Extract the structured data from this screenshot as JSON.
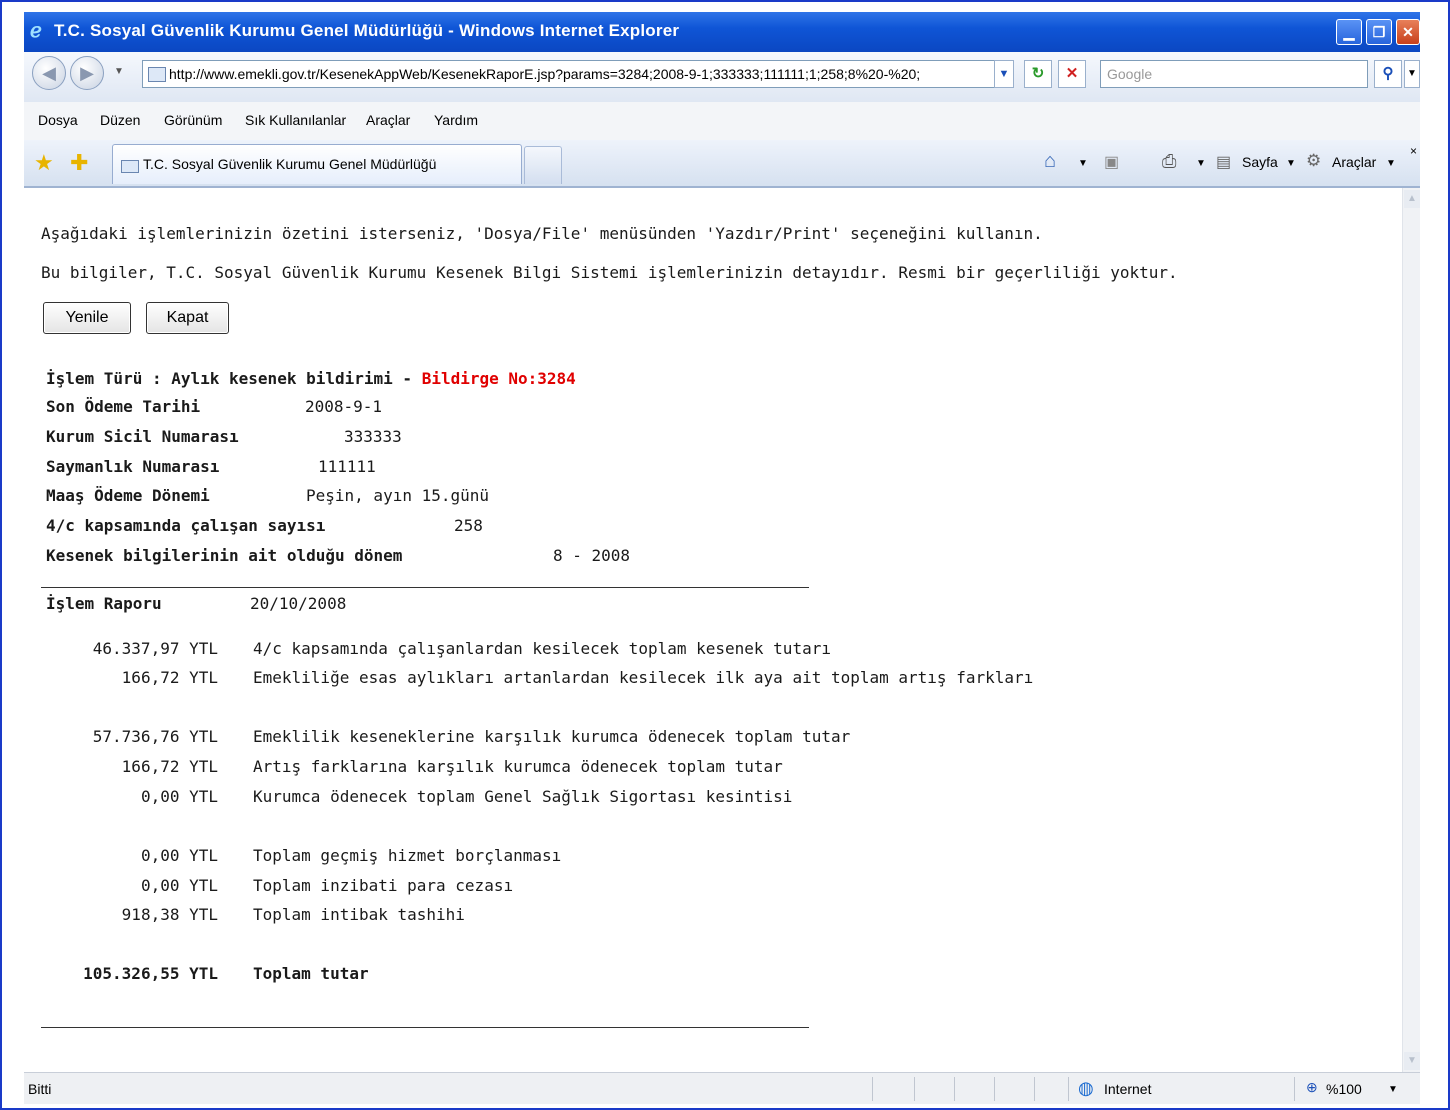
{
  "window": {
    "title": "T.C. Sosyal Güvenlik Kurumu Genel Müdürlüğü - Windows Internet Explorer"
  },
  "address": {
    "url": "http://www.emekli.gov.tr/KesenekAppWeb/KesenekRaporE.jsp?params=3284;2008-9-1;333333;111111;1;258;8%20-%20;",
    "search_placeholder": "Google"
  },
  "menu": [
    "Dosya",
    "Düzen",
    "Görünüm",
    "Sık Kullanılanlar",
    "Araçlar",
    "Yardım"
  ],
  "tab": {
    "title": "T.C. Sosyal Güvenlik Kurumu Genel Müdürlüğü"
  },
  "toolbar": {
    "page_label": "Sayfa",
    "tools_label": "Araçlar"
  },
  "content": {
    "info_line1": "Aşağıdaki işlemlerinizin özetini isterseniz, 'Dosya/File' menüsünden 'Yazdır/Print' seçeneğini kullanın.",
    "info_line2": "Bu bilgiler, T.C. Sosyal Güvenlik Kurumu Kesenek Bilgi Sistemi işlemlerinizin detayıdır. Resmi bir geçerliliği yoktur.",
    "refresh_button": "Yenile",
    "close_button": "Kapat",
    "operation_type_label": "İşlem Türü : Aylık kesenek bildirimi - ",
    "bildirge_no": "Bildirge No:3284",
    "fields": [
      {
        "label": "Son Ödeme Tarihi",
        "value": "2008-9-1"
      },
      {
        "label": "Kurum Sicil Numarası",
        "value": "333333"
      },
      {
        "label": "Saymanlık Numarası",
        "value": "111111"
      },
      {
        "label": "Maaş Ödeme Dönemi",
        "value": "Peşin, ayın 15.günü"
      },
      {
        "label": "4/c kapsamında çalışan sayısı",
        "value": "258"
      },
      {
        "label": "Kesenek bilgilerinin ait olduğu dönem",
        "value": "8 - 2008"
      }
    ],
    "report_label": "İşlem Raporu",
    "report_date": "20/10/2008",
    "report_rows": [
      {
        "amount": "46.337,97 YTL",
        "desc": "4/c kapsamında çalışanlardan kesilecek toplam kesenek tutarı"
      },
      {
        "amount": "166,72 YTL",
        "desc": "Emekliliğe esas aylıkları artanlardan kesilecek ilk aya ait toplam artış farkları"
      },
      {
        "amount": "57.736,76 YTL",
        "desc": "Emeklilik keseneklerine karşılık kurumca ödenecek toplam tutar"
      },
      {
        "amount": "166,72 YTL",
        "desc": "Artış farklarına karşılık kurumca ödenecek toplam tutar"
      },
      {
        "amount": "0,00 YTL",
        "desc": "Kurumca ödenecek toplam Genel Sağlık Sigortası kesintisi"
      },
      {
        "amount": "0,00 YTL",
        "desc": "Toplam geçmiş hizmet borçlanması"
      },
      {
        "amount": "0,00 YTL",
        "desc": "Toplam inzibati para cezası"
      },
      {
        "amount": "918,38 YTL",
        "desc": "Toplam intibak tashihi"
      }
    ],
    "total_amount": "105.326,55 YTL",
    "total_label": "Toplam tutar"
  },
  "status": {
    "text": "Bitti",
    "zone": "Internet",
    "zoom": "%100"
  }
}
